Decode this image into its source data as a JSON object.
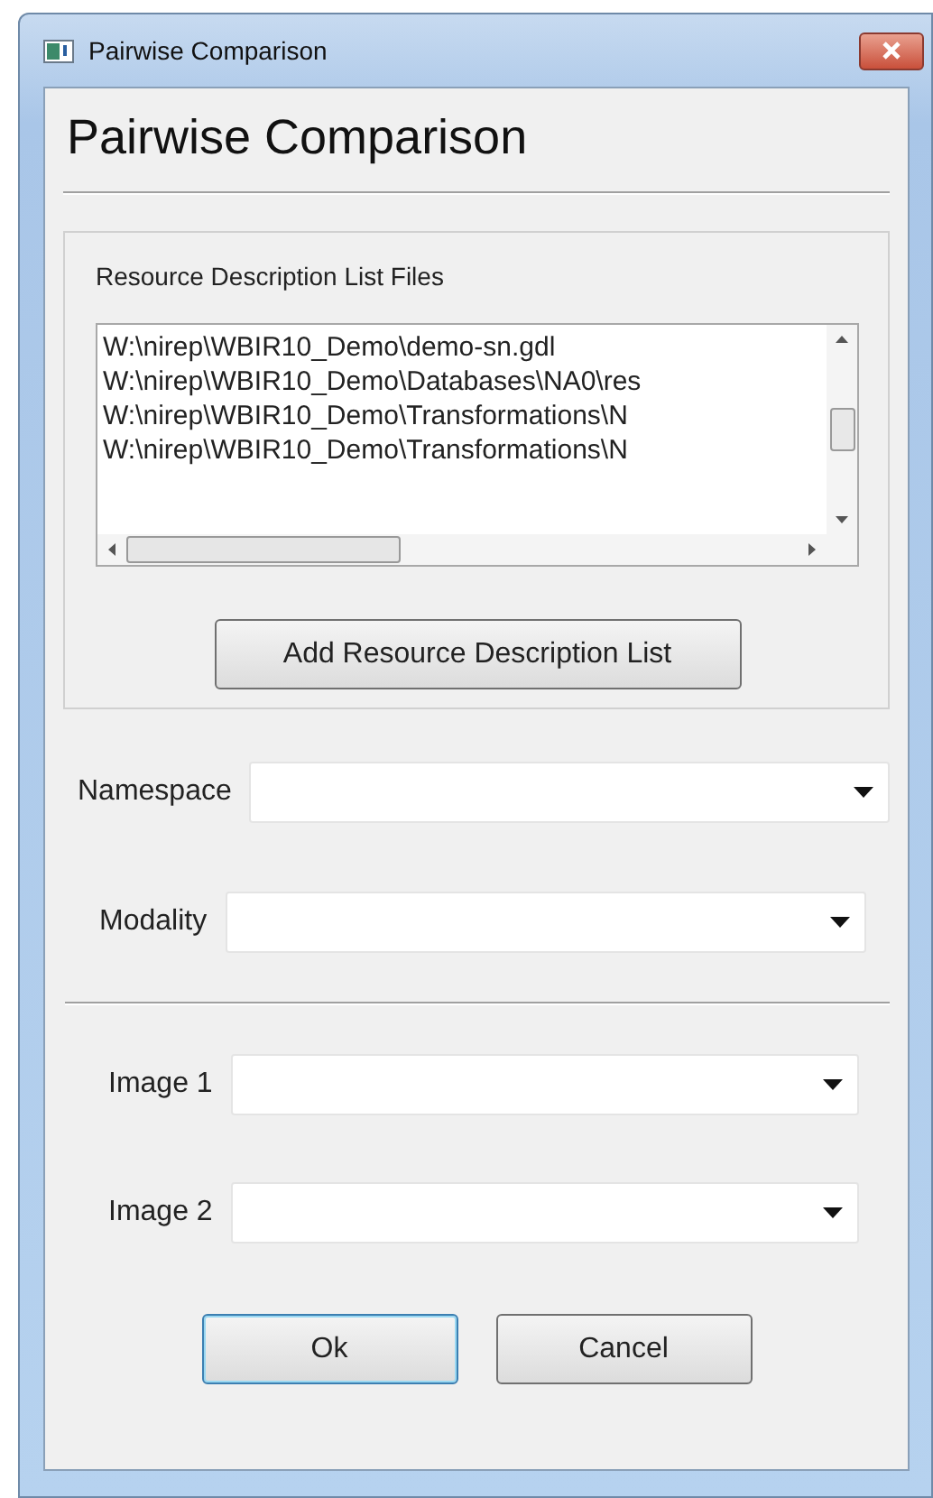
{
  "window": {
    "title": "Pairwise Comparison"
  },
  "heading": "Pairwise Comparison",
  "resource_group": {
    "label": "Resource Description List Files",
    "files": [
      {
        "path": "W:\\nirep\\WBIR10_Demo\\demo-sn.gdl",
        "selected": false
      },
      {
        "path": "W:\\nirep\\WBIR10_Demo\\Databases\\NA0\\res",
        "selected": false
      },
      {
        "path": "W:\\nirep\\WBIR10_Demo\\Transformations\\N",
        "selected": false
      },
      {
        "path": "W:\\nirep\\WBIR10_Demo\\Transformations\\N",
        "selected": false
      }
    ],
    "add_button": "Add Resource Description List"
  },
  "fields": [
    {
      "label": "Namespace"
    },
    {
      "label": "Modality"
    },
    {
      "label": "Image 1"
    },
    {
      "label": "Image 2"
    }
  ],
  "buttons": [
    {
      "label": "Ok",
      "default": true
    },
    {
      "label": "Cancel",
      "default": false
    }
  ]
}
